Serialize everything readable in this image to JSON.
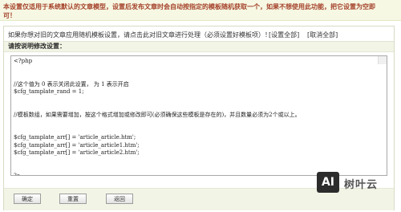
{
  "notice": {
    "line1": "本设置仅适用于系统默认的文章模型，设置后发布文章时会自动按指定的模板随机获取一个，如果不想使用此功能，把它设置为空即",
    "line2": "可！"
  },
  "top_row": {
    "text": "如果你想对旧的文章应用随机模板设置，请点击此对旧文章进行处理（必须设置好模板项）！",
    "set_all_link": "[设置全部]",
    "cancel_all_link": "[取消全部]"
  },
  "section": {
    "title": "请按说明修改设置："
  },
  "editor": {
    "lines": [
      "<?php",
      "",
      "",
      "//这个值为 0 表示关闭此设置， 为 1 表示开启",
      "$cfg_tamplate_rand = 1;",
      "",
      "",
      "//模板数组，如果需要增加，按这个格式增加或修改即可(必须确保这些模板是存在的)，并且数量必须为2个或以上。",
      "",
      "",
      "$cfg_tamplate_arr[] = 'article_article.htm';",
      "$cfg_tamplate_arr[] = 'article_article1.htm';",
      "$cfg_tamplate_arr[] = 'article_article2.htm';",
      "",
      "",
      "?>"
    ]
  },
  "buttons": {
    "confirm": "确定",
    "reset": "重置",
    "back": "返回"
  },
  "watermark": {
    "box": "AI",
    "text": "树叶云"
  }
}
